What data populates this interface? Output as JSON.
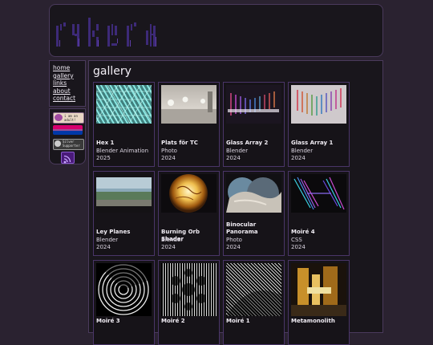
{
  "site": {
    "logo_text": "rykera"
  },
  "nav": {
    "items": [
      "home",
      "gallery",
      "links",
      "about",
      "contact"
    ]
  },
  "badges": [
    {
      "name": "i-am-an-adult-badge",
      "text": "i am an adult!"
    },
    {
      "name": "pride-flag-badge",
      "text": ""
    },
    {
      "name": "silver-supporter-badge",
      "text": "Silver Supporter"
    },
    {
      "name": "rss-feed-badge",
      "text": ""
    }
  ],
  "page": {
    "title": "gallery"
  },
  "gallery": {
    "items": [
      {
        "title": "Hex 1",
        "type": "Blender Animation",
        "year": "2025"
      },
      {
        "title": "Plats för TC",
        "type": "Photo",
        "year": "2024"
      },
      {
        "title": "Glass Array 2",
        "type": "Blender",
        "year": "2024"
      },
      {
        "title": "Glass Array 1",
        "type": "Blender",
        "year": "2024"
      },
      {
        "title": "Ley Planes",
        "type": "Blender",
        "year": "2024"
      },
      {
        "title": "Burning Orb Shader",
        "type": "Blender",
        "year": "2024"
      },
      {
        "title": "Binocular Panorama",
        "type": "Photo",
        "year": "2024"
      },
      {
        "title": "Moiré 4",
        "type": "CSS",
        "year": "2024"
      },
      {
        "title": "Moiré 3",
        "type": "",
        "year": ""
      },
      {
        "title": "Moiré 2",
        "type": "",
        "year": ""
      },
      {
        "title": "Moiré 1",
        "type": "",
        "year": ""
      },
      {
        "title": "Metamonolith",
        "type": "",
        "year": ""
      }
    ]
  }
}
